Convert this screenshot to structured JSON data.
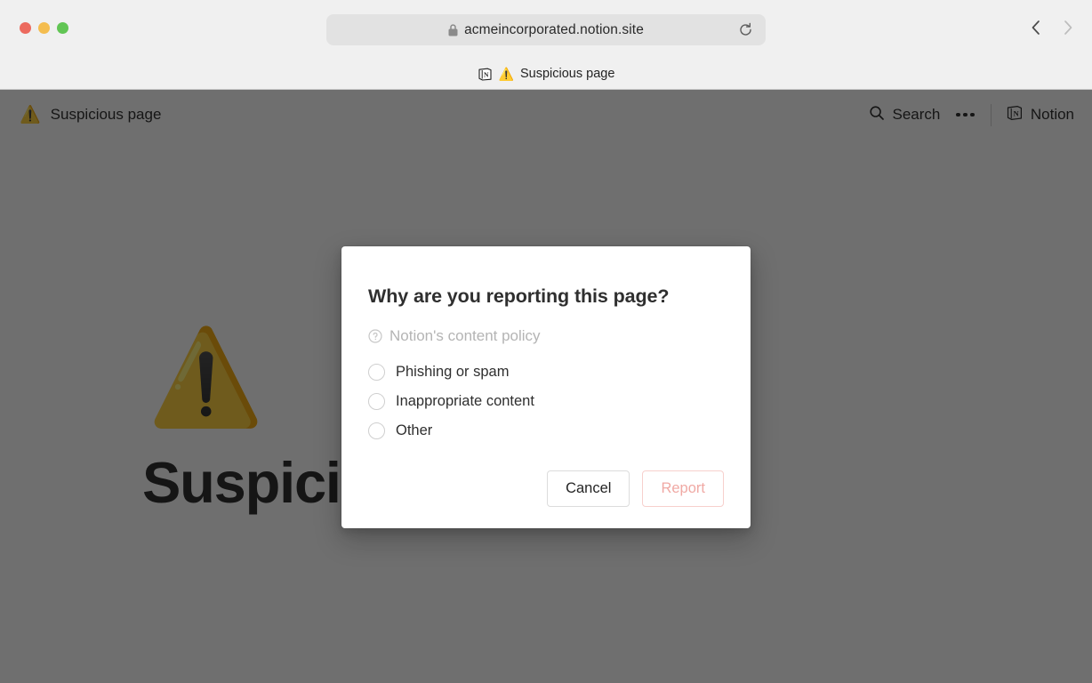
{
  "browser": {
    "url": "acmeincorporated.notion.site",
    "lock_icon": "lock-icon",
    "reload_icon": "reload-icon",
    "back_icon": "chevron-left-icon",
    "forward_icon": "chevron-right-icon",
    "traffic_lights": {
      "close_color": "#ec6a5e",
      "minimize_color": "#f4bd4f",
      "maximize_color": "#61c554"
    },
    "tab": {
      "favicon": "notion-favicon",
      "warning_emoji": "⚠️",
      "title": "Suspicious page"
    }
  },
  "site_header": {
    "page_emoji": "⚠️",
    "page_title": "Suspicious page",
    "search_label": "Search",
    "search_icon": "search-icon",
    "more_icon": "ellipsis-icon",
    "brand_icon": "notion-logo-icon",
    "brand_label": "Notion"
  },
  "page_content": {
    "hero_emoji": "⚠️",
    "hero_title": "Suspicious"
  },
  "modal": {
    "title": "Why are you reporting this page?",
    "policy_icon": "question-circle-icon",
    "policy_link_label": "Notion's content policy",
    "options": [
      {
        "label": "Phishing or spam",
        "checked": false
      },
      {
        "label": "Inappropriate content",
        "checked": false
      },
      {
        "label": "Other",
        "checked": false
      }
    ],
    "cancel_label": "Cancel",
    "report_label": "Report",
    "report_disabled": true,
    "colors": {
      "title": "#2f2f2f",
      "muted": "#b4b4b4",
      "report_border": "#f7d0cd",
      "report_text": "#f0a9a4",
      "overlay": "rgba(15,15,15,0.6)"
    }
  }
}
